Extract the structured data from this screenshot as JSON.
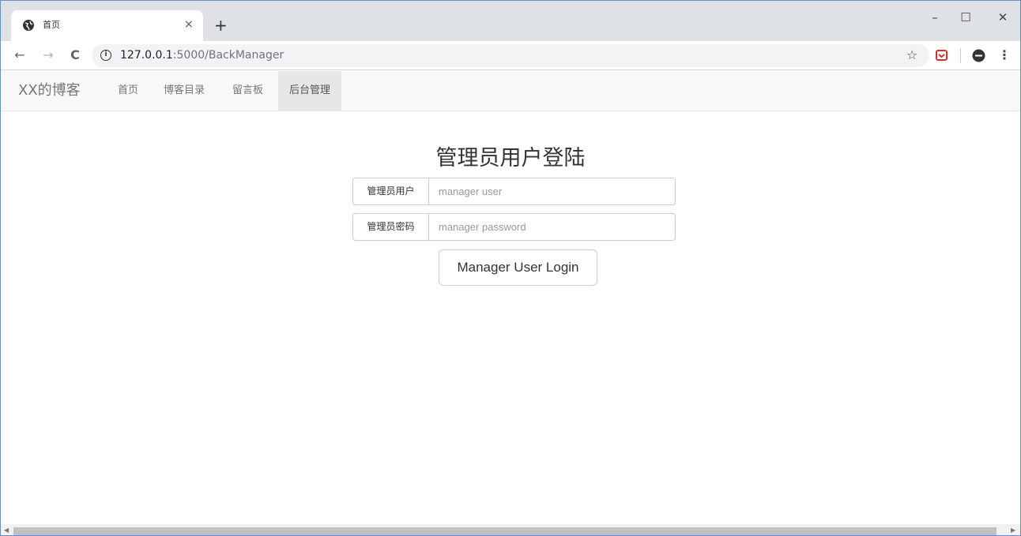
{
  "browser": {
    "tab_title": "首页",
    "tab_close": "×",
    "new_tab": "+",
    "url_host": "127.0.0.1",
    "url_path": ":5000/BackManager",
    "window_controls": {
      "minimize": "–",
      "maximize": "☐",
      "close": "✕"
    },
    "nav": {
      "back": "←",
      "forward": "→",
      "reload": "C"
    },
    "info_icon": "i",
    "bookmark_star": "☆",
    "profile_icon": "⊖",
    "menu": "⋮"
  },
  "site_nav": {
    "brand": "XX的博客",
    "links": [
      {
        "label": "首页"
      },
      {
        "label": "博客目录"
      },
      {
        "label": "留言板"
      },
      {
        "label": "后台管理"
      }
    ]
  },
  "login": {
    "heading": "管理员用户登陆",
    "user_label": "管理员用户",
    "user_placeholder": "manager user",
    "password_label": "管理员密码",
    "password_placeholder": "manager password",
    "button_label": "Manager User Login"
  },
  "colors": {
    "accent": "#6a8fc7",
    "tabstrip": "#dee1e6",
    "navbar": "#f8f8f8",
    "active_nav": "#e7e7e7",
    "extension_red": "#d93025"
  }
}
